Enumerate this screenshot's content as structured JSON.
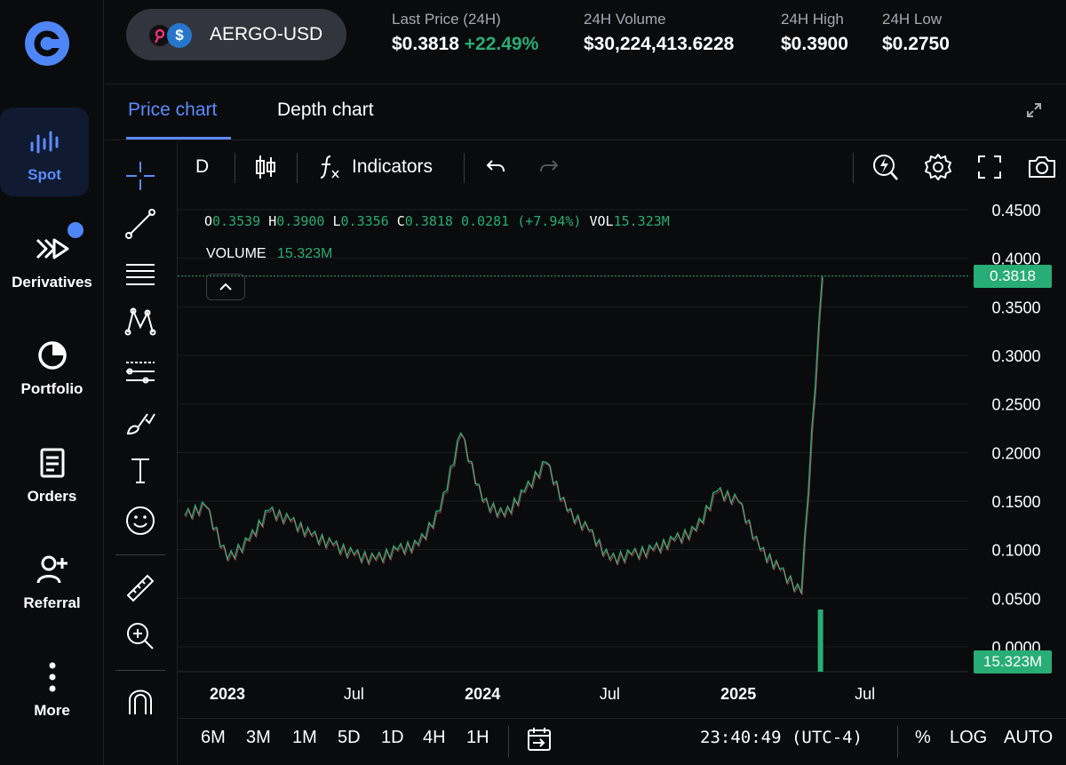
{
  "nav": {
    "items": [
      {
        "label": "Spot",
        "icon": "bar-chart-icon"
      },
      {
        "label": "Derivatives",
        "icon": "derivatives-icon"
      },
      {
        "label": "Portfolio",
        "icon": "pie-chart-icon"
      },
      {
        "label": "Orders",
        "icon": "document-icon"
      },
      {
        "label": "Referral",
        "icon": "add-user-icon"
      },
      {
        "label": "More",
        "icon": "more-vertical-icon"
      }
    ],
    "accent": "#5b8cff",
    "notification_color": "#4f86f7"
  },
  "header": {
    "pair": "AERGO-USD",
    "stats": [
      {
        "label": "Last Price (24H)",
        "value": "$0.3818",
        "change": "+22.49%"
      },
      {
        "label": "24H Volume",
        "value": "$30,224,413.6228"
      },
      {
        "label": "24H High",
        "value": "$0.3900"
      },
      {
        "label": "24H Low",
        "value": "$0.2750"
      }
    ],
    "up_color": "#27ad75"
  },
  "tabs": [
    {
      "label": "Price chart",
      "active": true
    },
    {
      "label": "Depth chart",
      "active": false
    }
  ],
  "toolbar": {
    "interval": "D",
    "indicators_label": "Indicators"
  },
  "legend": {
    "o_label": "O",
    "o_value": "0.3539",
    "h_label": "H",
    "h_value": "0.3900",
    "l_label": "L",
    "l_value": "0.3356",
    "c_label": "C",
    "c_value": "0.3818",
    "change": "0.0281 (+7.94%)",
    "vol_label": "VOL",
    "vol_value": "15.323M",
    "volume_label": "VOLUME",
    "volume_value": "15.323M"
  },
  "chart_data": {
    "type": "line",
    "series": [
      {
        "x": [
          "2022-11",
          "2022-12",
          "2023-01",
          "2023-02",
          "2023-03",
          "2023-04",
          "2023-05",
          "2023-06",
          "2023-07",
          "2023-08",
          "2023-09",
          "2023-10",
          "2023-11",
          "2023-12",
          "2024-01",
          "2024-02",
          "2024-03",
          "2024-04",
          "2024-05",
          "2024-06",
          "2024-07",
          "2024-08",
          "2024-09",
          "2024-10",
          "2024-11",
          "2024-12",
          "2025-01",
          "2025-02",
          "2025-03",
          "2025-04",
          "2025-05"
        ],
        "values": [
          0.135,
          0.145,
          0.09,
          0.11,
          0.14,
          0.13,
          0.115,
          0.105,
          0.095,
          0.09,
          0.1,
          0.105,
          0.14,
          0.22,
          0.15,
          0.135,
          0.16,
          0.19,
          0.14,
          0.12,
          0.09,
          0.095,
          0.1,
          0.11,
          0.12,
          0.16,
          0.15,
          0.1,
          0.08,
          0.055,
          0.3818
        ]
      }
    ],
    "x_ticks": [
      "2023",
      "Jul",
      "2024",
      "Jul",
      "2025",
      "Jul"
    ],
    "y_ticks": [
      "0.4500",
      "0.4000",
      "0.3500",
      "0.3000",
      "0.2500",
      "0.2000",
      "0.1500",
      "0.1000",
      "0.0500",
      "0.0000"
    ],
    "ylim": [
      0,
      0.45
    ],
    "last_price_label": "0.3818",
    "volume_tag": "15.323M",
    "up_color": "#27ad75",
    "down_color": "#f0616d"
  },
  "bottom": {
    "ranges": [
      "6M",
      "3M",
      "1M",
      "5D",
      "1D",
      "4H",
      "1H"
    ],
    "time": "23:40:49 (UTC-4)",
    "percent": "%",
    "log": "LOG",
    "auto": "AUTO"
  }
}
